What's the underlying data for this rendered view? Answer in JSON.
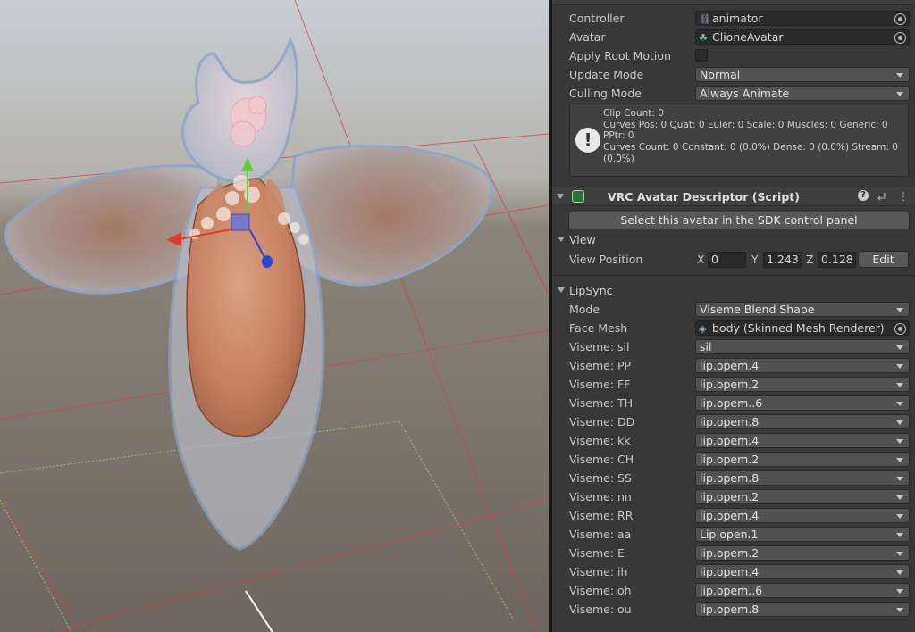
{
  "animator": {
    "controller_label": "Controller",
    "controller_value": "animator",
    "avatar_label": "Avatar",
    "avatar_value": "ClioneAvatar",
    "apply_root_motion_label": "Apply Root Motion",
    "apply_root_motion_checked": false,
    "update_mode_label": "Update Mode",
    "update_mode_value": "Normal",
    "culling_mode_label": "Culling Mode",
    "culling_mode_value": "Always Animate",
    "info_lines": [
      "Clip Count: 0",
      "Curves Pos: 0 Quat: 0 Euler: 0 Scale: 0 Muscles: 0 Generic: 0",
      "PPtr: 0",
      "Curves Count: 0 Constant: 0 (0.0%) Dense: 0 (0.0%) Stream: 0",
      "(0.0%)"
    ]
  },
  "descriptor": {
    "title": "VRC Avatar Descriptor (Script)",
    "select_button": "Select this avatar in the SDK control panel",
    "view_section": "View",
    "view_position_label": "View Position",
    "x_label": "X",
    "x_value": "0",
    "y_label": "Y",
    "y_value": "1.243",
    "z_label": "Z",
    "z_value": "0.128",
    "edit_button": "Edit",
    "lipsync_section": "LipSync",
    "mode_label": "Mode",
    "mode_value": "Viseme Blend Shape",
    "face_mesh_label": "Face Mesh",
    "face_mesh_value": "body (Skinned Mesh Renderer)",
    "visemes": [
      {
        "label": "Viseme: sil",
        "value": "sil"
      },
      {
        "label": "Viseme: PP",
        "value": "lip.opem.4"
      },
      {
        "label": "Viseme: FF",
        "value": "lip.opem.2"
      },
      {
        "label": "Viseme: TH",
        "value": "lip.opem..6"
      },
      {
        "label": "Viseme: DD",
        "value": "lip.opem.8"
      },
      {
        "label": "Viseme: kk",
        "value": "lip.opem.4"
      },
      {
        "label": "Viseme: CH",
        "value": "lip.opem.2"
      },
      {
        "label": "Viseme: SS",
        "value": "lip.opem.8"
      },
      {
        "label": "Viseme: nn",
        "value": "lip.opem.2"
      },
      {
        "label": "Viseme: RR",
        "value": "lip.opem.4"
      },
      {
        "label": "Viseme: aa",
        "value": "Lip.open.1"
      },
      {
        "label": "Viseme: E",
        "value": "lip.opem.2"
      },
      {
        "label": "Viseme: ih",
        "value": "lip.opem.4"
      },
      {
        "label": "Viseme: oh",
        "value": "lip.opem..6"
      },
      {
        "label": "Viseme: ou",
        "value": "lip.opem.8"
      }
    ]
  },
  "icons": {
    "animator_controller": "animator-controller-icon",
    "avatar": "avatar-figure-icon",
    "mesh": "skinned-mesh-icon",
    "warning": "info-warning-icon",
    "help": "help-icon",
    "presets": "presets-icon",
    "menu": "kebab-menu-icon"
  }
}
